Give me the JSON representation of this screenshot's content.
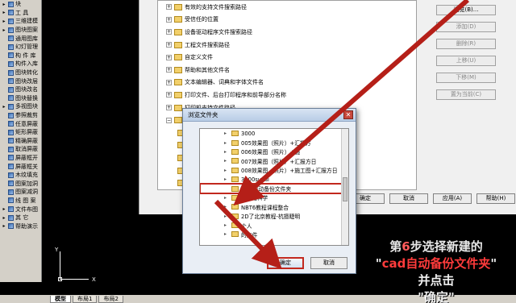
{
  "palette": [
    {
      "arrow": "▸",
      "label": "块"
    },
    {
      "arrow": "▸",
      "label": "工  具"
    },
    {
      "arrow": "▸",
      "label": "三维建模"
    },
    {
      "arrow": "▸",
      "label": "图块图案"
    },
    {
      "arrow": "",
      "label": "通用图库"
    },
    {
      "arrow": "",
      "label": "幻灯管理"
    },
    {
      "arrow": "",
      "label": "构 件 库"
    },
    {
      "arrow": "",
      "label": "构件入库"
    },
    {
      "arrow": "",
      "label": "图块转化"
    },
    {
      "arrow": "",
      "label": "图块改层"
    },
    {
      "arrow": "",
      "label": "图块改名"
    },
    {
      "arrow": "",
      "label": "图块替换"
    },
    {
      "arrow": "▸",
      "label": "多视图块"
    },
    {
      "arrow": "",
      "label": "参照裁剪"
    },
    {
      "arrow": "",
      "label": "任意屏蔽"
    },
    {
      "arrow": "",
      "label": "矩形屏蔽"
    },
    {
      "arrow": "",
      "label": "精确屏蔽"
    },
    {
      "arrow": "",
      "label": "取消屏蔽"
    },
    {
      "arrow": "",
      "label": "屏蔽框开"
    },
    {
      "arrow": "",
      "label": "屏蔽框关"
    },
    {
      "arrow": "",
      "label": "木纹填充"
    },
    {
      "arrow": "",
      "label": "图案加洞"
    },
    {
      "arrow": "",
      "label": "图案减洞"
    },
    {
      "arrow": "",
      "label": "线 图 案"
    },
    {
      "arrow": "▸",
      "label": "文件布图"
    },
    {
      "arrow": "▸",
      "label": "其    它"
    },
    {
      "arrow": "▸",
      "label": "帮助演示"
    }
  ],
  "options_tree": [
    {
      "exp": "+",
      "label": "有效的支持文件搜索路径"
    },
    {
      "exp": "+",
      "label": "受信任的位置"
    },
    {
      "exp": "+",
      "label": "设备驱动程序文件搜索路径"
    },
    {
      "exp": "+",
      "label": "工程文件搜索路径"
    },
    {
      "exp": "+",
      "label": "自定义文件"
    },
    {
      "exp": "+",
      "label": "帮助和其他文件名"
    },
    {
      "exp": "+",
      "label": "文本编辑器、词典和字体文件名"
    },
    {
      "exp": "+",
      "label": "打印文件、后台打印程序和前导部分名称"
    },
    {
      "exp": "+",
      "label": "打印机支持文件路径"
    },
    {
      "exp": "−",
      "label": "自动保存文件位置"
    }
  ],
  "options_side_buttons": [
    "浏览(B)...",
    "添加(D)",
    "删除(R)",
    "上移(U)",
    "下移(M)",
    "置为当前(C)"
  ],
  "options_bottom_buttons": [
    "确定",
    "取消",
    "应用(A)",
    "帮助(H)"
  ],
  "browse": {
    "title": "浏览文件夹",
    "close": "✕",
    "items": [
      {
        "arrow": "▸",
        "label": "3000"
      },
      {
        "arrow": "▸",
        "label": "005效果图（照片）+汇报方"
      },
      {
        "arrow": "▸",
        "label": "006效果图（照片）+施"
      },
      {
        "arrow": "▸",
        "label": "007效果图（照片）+汇报方日"
      },
      {
        "arrow": "▸",
        "label": "008效果图（照片）+施工图+汇报方日"
      },
      {
        "arrow": "▸",
        "label": "3000sucai"
      },
      {
        "arrow": "",
        "label": "CAD自动备份文件夹"
      },
      {
        "arrow": "▸",
        "label": "IT视图科学"
      },
      {
        "arrow": "▸",
        "label": "NBT6教程课程整合"
      },
      {
        "arrow": "▸",
        "label": "2D了北京教程-杭擅睫明"
      },
      {
        "arrow": "▸",
        "label": "个人"
      },
      {
        "arrow": "▸",
        "label": "的文件"
      }
    ],
    "selected_index": 6,
    "ok": "确定",
    "cancel": "取消"
  },
  "tabs": [
    "模型",
    "布局1",
    "布局2"
  ],
  "ucs": {
    "y": "Y",
    "x": "X"
  },
  "annotation": {
    "line1_prefix": "第",
    "line1_step": "6",
    "line1_suffix": "步选择新建的",
    "line2_quote_open": "\"",
    "line2_text": "cad自动备份文件夹",
    "line2_quote_close": "\"",
    "line3": "并点击",
    "line4": "\"确定\""
  },
  "colors": {
    "arrow_red": "#b51f18",
    "highlight_red": "#c2281e",
    "annotation_red": "#ff4040"
  }
}
